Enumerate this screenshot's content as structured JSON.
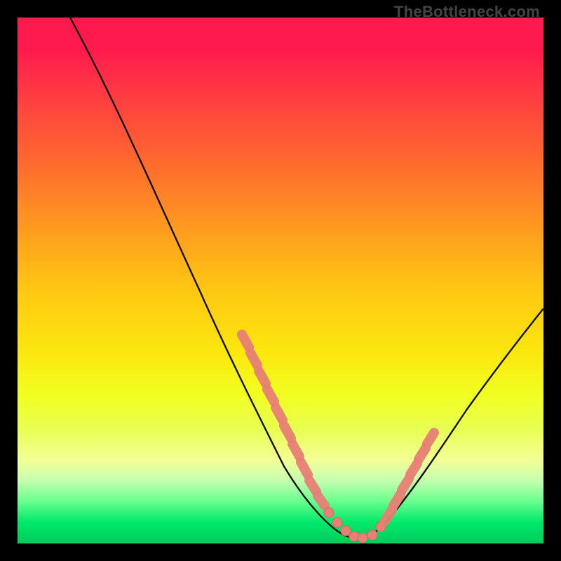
{
  "watermark": "TheBottleneck.com",
  "colors": {
    "frame": "#000000",
    "curve": "#111111",
    "marker": "#e88076",
    "gradient_top": "#ff1a4d",
    "gradient_bottom": "#00cc5c"
  },
  "chart_data": {
    "type": "line",
    "title": "",
    "xlabel": "",
    "ylabel": "",
    "xlim": [
      0,
      100
    ],
    "ylim": [
      0,
      100
    ],
    "grid": false,
    "legend": false,
    "description": "V-shaped bottleneck curve on a red-to-green vertical heat gradient; lowest (best) region near x≈57-67. Salmon markers cluster on the descending and ascending flanks near the bottom.",
    "series": [
      {
        "name": "bottleneck_curve",
        "x": [
          10,
          15,
          20,
          25,
          30,
          35,
          40,
          45,
          50,
          53,
          55,
          57,
          60,
          63,
          65,
          67,
          70,
          75,
          80,
          85,
          90,
          95,
          100
        ],
        "y": [
          100,
          92,
          83,
          74,
          65,
          56,
          47,
          37,
          26,
          18,
          12,
          7,
          3,
          1,
          1,
          2,
          6,
          15,
          25,
          34,
          42,
          50,
          56
        ]
      }
    ],
    "markers": {
      "left_cluster_x": [
        43,
        45,
        46,
        48,
        49,
        50,
        51,
        52,
        53,
        54,
        55,
        56,
        57,
        59,
        61,
        63
      ],
      "left_cluster_y": [
        41,
        37,
        35,
        31,
        29,
        26,
        24,
        21,
        18,
        16,
        13,
        10,
        7,
        5,
        3,
        1
      ],
      "right_cluster_x": [
        66,
        67,
        68,
        69,
        70,
        72,
        74,
        75,
        76
      ],
      "right_cluster_y": [
        1,
        2,
        4,
        5,
        7,
        10,
        14,
        16,
        18
      ]
    }
  }
}
